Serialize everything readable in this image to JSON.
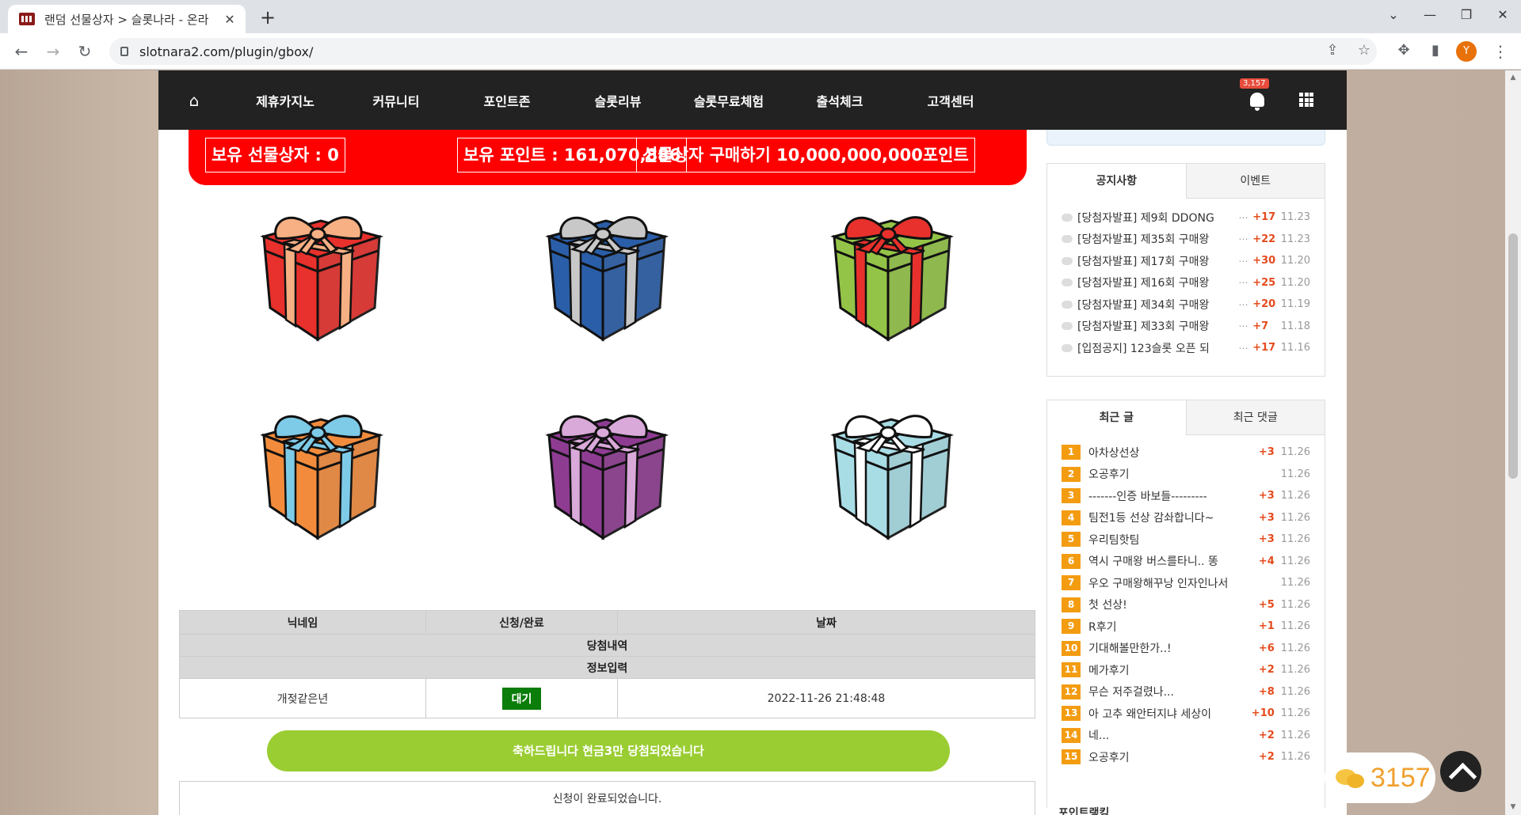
{
  "browser": {
    "tab_title": "랜덤 선물상자 > 슬롯나라 - 온라",
    "url": "slotnara2.com/plugin/gbox/",
    "profile_initial": "Y"
  },
  "nav": {
    "items": [
      "제휴카지노",
      "커뮤니티",
      "포인트존",
      "슬롯리뷰",
      "슬롯무료체험",
      "출석체크",
      "고객센터"
    ],
    "notification_count": "3,157"
  },
  "banner": {
    "gift_count": "보유 선물상자 : 0",
    "points": "보유 포인트 : 161,070,886",
    "buy": "선물상자 구매하기 10,000,000,000포인트"
  },
  "gifts": [
    {
      "name": "gift-red",
      "box": "#e8312c",
      "ribbon": "#f7b083"
    },
    {
      "name": "gift-blue",
      "box": "#2a5ea8",
      "ribbon": "#c8c8c8"
    },
    {
      "name": "gift-green",
      "box": "#94c447",
      "ribbon": "#e8312c"
    },
    {
      "name": "gift-orange",
      "box": "#f28c3c",
      "ribbon": "#7ecbe8"
    },
    {
      "name": "gift-purple",
      "box": "#8e3c92",
      "ribbon": "#d9a9d9"
    },
    {
      "name": "gift-lightblue",
      "box": "#a9dde6",
      "ribbon": "#ffffff"
    }
  ],
  "table": {
    "headers": [
      "닉네임",
      "신청/완료",
      "날짜"
    ],
    "section1": "당첨내역",
    "section2": "정보입력",
    "row": {
      "nickname": "개젖같은년",
      "status": "대기",
      "date": "2022-11-26 21:48:48"
    },
    "congrats": "축하드립니다 현금3만 당첨되었습니다",
    "done": "신청이 완료되었습니다."
  },
  "notice_panel": {
    "tabs": [
      "공지사항",
      "이벤트"
    ],
    "items": [
      {
        "title": "[당첨자발표] 제9회 DDONG",
        "count": "+17",
        "date": "11.23"
      },
      {
        "title": "[당첨자발표] 제35회 구매왕",
        "count": "+22",
        "date": "11.23"
      },
      {
        "title": "[당첨자발표] 제17회 구매왕",
        "count": "+30",
        "date": "11.20"
      },
      {
        "title": "[당첨자발표] 제16회 구매왕",
        "count": "+25",
        "date": "11.20"
      },
      {
        "title": "[당첨자발표] 제34회 구매왕",
        "count": "+20",
        "date": "11.19"
      },
      {
        "title": "[당첨자발표] 제33회 구매왕",
        "count": "+7",
        "date": "11.18"
      },
      {
        "title": "[입점공지] 123슬롯 오픈 되",
        "count": "+17",
        "date": "11.16"
      }
    ]
  },
  "recent_panel": {
    "tabs": [
      "최근 글",
      "최근 댓글"
    ],
    "items": [
      {
        "rank": "1",
        "title": "아차상선상",
        "count": "+3",
        "date": "11.26"
      },
      {
        "rank": "2",
        "title": "오공후기",
        "count": "",
        "date": "11.26"
      },
      {
        "rank": "3",
        "title": "-------인증 바보들---------",
        "count": "+3",
        "date": "11.26"
      },
      {
        "rank": "4",
        "title": "팀전1등 선상 감솨합니다~",
        "count": "+3",
        "date": "11.26"
      },
      {
        "rank": "5",
        "title": "우리팀핫팀",
        "count": "+3",
        "date": "11.26"
      },
      {
        "rank": "6",
        "title": "역시 구매왕 버스를타니.. 똥",
        "count": "+4",
        "date": "11.26"
      },
      {
        "rank": "7",
        "title": "우오 구매왕해꾸낭 인자인나서",
        "count": "",
        "date": "11.26"
      },
      {
        "rank": "8",
        "title": "첫 선상!",
        "count": "+5",
        "date": "11.26"
      },
      {
        "rank": "9",
        "title": "R후기",
        "count": "+1",
        "date": "11.26"
      },
      {
        "rank": "10",
        "title": "기대해볼만한가..!",
        "count": "+6",
        "date": "11.26"
      },
      {
        "rank": "11",
        "title": "메가후기",
        "count": "+2",
        "date": "11.26"
      },
      {
        "rank": "12",
        "title": "무슨 저주걸렸나...",
        "count": "+8",
        "date": "11.26"
      },
      {
        "rank": "13",
        "title": "아 고추 왜안터지냐 세상이",
        "count": "+10",
        "date": "11.26"
      },
      {
        "rank": "14",
        "title": "네...",
        "count": "+2",
        "date": "11.26"
      },
      {
        "rank": "15",
        "title": "오공후기",
        "count": "+2",
        "date": "11.26"
      }
    ]
  },
  "point_rank_title": "포인트랭킹",
  "float_count": "3157"
}
